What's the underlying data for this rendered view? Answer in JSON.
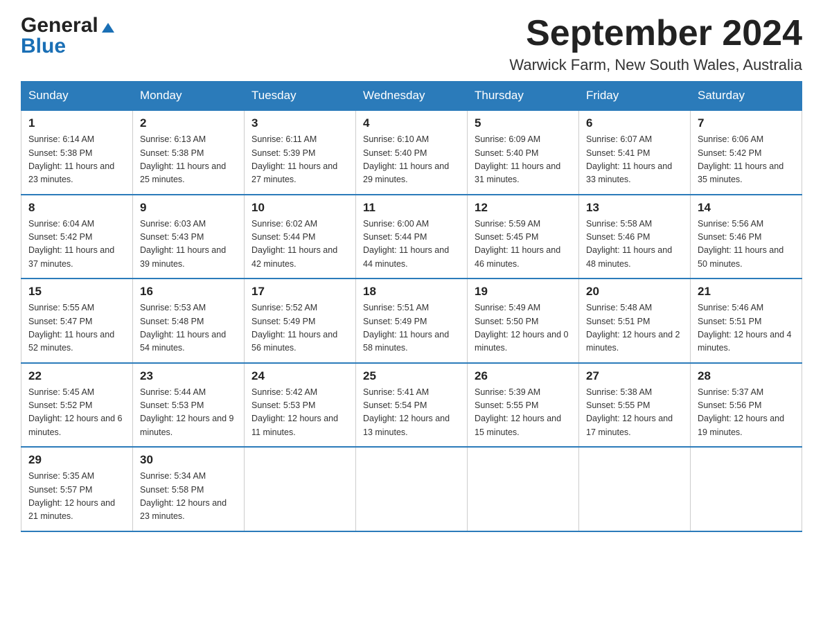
{
  "header": {
    "logo_line1": "General",
    "logo_line2": "Blue",
    "month_title": "September 2024",
    "location": "Warwick Farm, New South Wales, Australia"
  },
  "weekdays": [
    "Sunday",
    "Monday",
    "Tuesday",
    "Wednesday",
    "Thursday",
    "Friday",
    "Saturday"
  ],
  "weeks": [
    [
      {
        "day": "1",
        "sunrise": "6:14 AM",
        "sunset": "5:38 PM",
        "daylight": "11 hours and 23 minutes."
      },
      {
        "day": "2",
        "sunrise": "6:13 AM",
        "sunset": "5:38 PM",
        "daylight": "11 hours and 25 minutes."
      },
      {
        "day": "3",
        "sunrise": "6:11 AM",
        "sunset": "5:39 PM",
        "daylight": "11 hours and 27 minutes."
      },
      {
        "day": "4",
        "sunrise": "6:10 AM",
        "sunset": "5:40 PM",
        "daylight": "11 hours and 29 minutes."
      },
      {
        "day": "5",
        "sunrise": "6:09 AM",
        "sunset": "5:40 PM",
        "daylight": "11 hours and 31 minutes."
      },
      {
        "day": "6",
        "sunrise": "6:07 AM",
        "sunset": "5:41 PM",
        "daylight": "11 hours and 33 minutes."
      },
      {
        "day": "7",
        "sunrise": "6:06 AM",
        "sunset": "5:42 PM",
        "daylight": "11 hours and 35 minutes."
      }
    ],
    [
      {
        "day": "8",
        "sunrise": "6:04 AM",
        "sunset": "5:42 PM",
        "daylight": "11 hours and 37 minutes."
      },
      {
        "day": "9",
        "sunrise": "6:03 AM",
        "sunset": "5:43 PM",
        "daylight": "11 hours and 39 minutes."
      },
      {
        "day": "10",
        "sunrise": "6:02 AM",
        "sunset": "5:44 PM",
        "daylight": "11 hours and 42 minutes."
      },
      {
        "day": "11",
        "sunrise": "6:00 AM",
        "sunset": "5:44 PM",
        "daylight": "11 hours and 44 minutes."
      },
      {
        "day": "12",
        "sunrise": "5:59 AM",
        "sunset": "5:45 PM",
        "daylight": "11 hours and 46 minutes."
      },
      {
        "day": "13",
        "sunrise": "5:58 AM",
        "sunset": "5:46 PM",
        "daylight": "11 hours and 48 minutes."
      },
      {
        "day": "14",
        "sunrise": "5:56 AM",
        "sunset": "5:46 PM",
        "daylight": "11 hours and 50 minutes."
      }
    ],
    [
      {
        "day": "15",
        "sunrise": "5:55 AM",
        "sunset": "5:47 PM",
        "daylight": "11 hours and 52 minutes."
      },
      {
        "day": "16",
        "sunrise": "5:53 AM",
        "sunset": "5:48 PM",
        "daylight": "11 hours and 54 minutes."
      },
      {
        "day": "17",
        "sunrise": "5:52 AM",
        "sunset": "5:49 PM",
        "daylight": "11 hours and 56 minutes."
      },
      {
        "day": "18",
        "sunrise": "5:51 AM",
        "sunset": "5:49 PM",
        "daylight": "11 hours and 58 minutes."
      },
      {
        "day": "19",
        "sunrise": "5:49 AM",
        "sunset": "5:50 PM",
        "daylight": "12 hours and 0 minutes."
      },
      {
        "day": "20",
        "sunrise": "5:48 AM",
        "sunset": "5:51 PM",
        "daylight": "12 hours and 2 minutes."
      },
      {
        "day": "21",
        "sunrise": "5:46 AM",
        "sunset": "5:51 PM",
        "daylight": "12 hours and 4 minutes."
      }
    ],
    [
      {
        "day": "22",
        "sunrise": "5:45 AM",
        "sunset": "5:52 PM",
        "daylight": "12 hours and 6 minutes."
      },
      {
        "day": "23",
        "sunrise": "5:44 AM",
        "sunset": "5:53 PM",
        "daylight": "12 hours and 9 minutes."
      },
      {
        "day": "24",
        "sunrise": "5:42 AM",
        "sunset": "5:53 PM",
        "daylight": "12 hours and 11 minutes."
      },
      {
        "day": "25",
        "sunrise": "5:41 AM",
        "sunset": "5:54 PM",
        "daylight": "12 hours and 13 minutes."
      },
      {
        "day": "26",
        "sunrise": "5:39 AM",
        "sunset": "5:55 PM",
        "daylight": "12 hours and 15 minutes."
      },
      {
        "day": "27",
        "sunrise": "5:38 AM",
        "sunset": "5:55 PM",
        "daylight": "12 hours and 17 minutes."
      },
      {
        "day": "28",
        "sunrise": "5:37 AM",
        "sunset": "5:56 PM",
        "daylight": "12 hours and 19 minutes."
      }
    ],
    [
      {
        "day": "29",
        "sunrise": "5:35 AM",
        "sunset": "5:57 PM",
        "daylight": "12 hours and 21 minutes."
      },
      {
        "day": "30",
        "sunrise": "5:34 AM",
        "sunset": "5:58 PM",
        "daylight": "12 hours and 23 minutes."
      },
      null,
      null,
      null,
      null,
      null
    ]
  ]
}
